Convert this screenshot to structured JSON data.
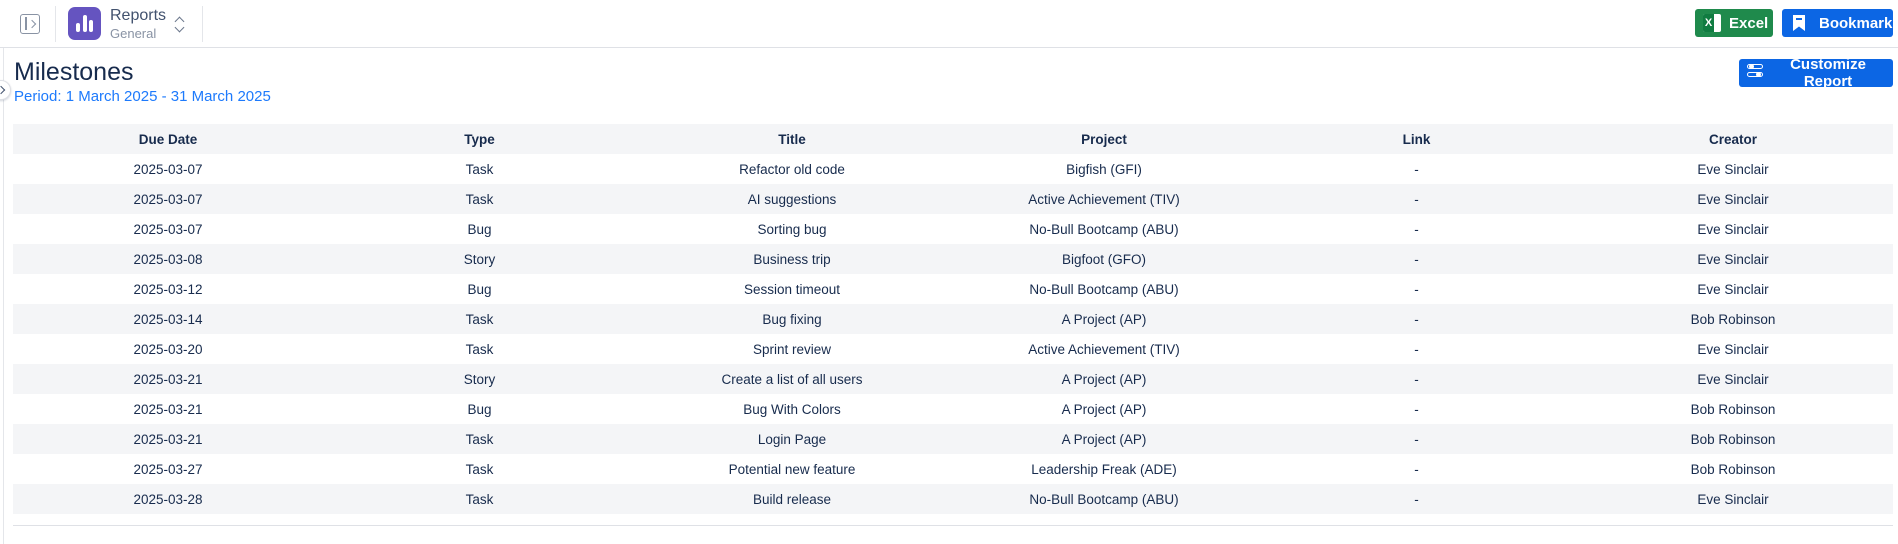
{
  "header": {
    "app_name": "Reports",
    "app_subtitle": "General",
    "excel_label": "Excel",
    "bookmark_label": "Bookmark",
    "icons": [
      "sidebar-toggle-icon",
      "bar-chart-icon",
      "chevron-updown-icon",
      "excel-icon",
      "bookmark-icon"
    ]
  },
  "report": {
    "title": "Milestones",
    "period": "Period: 1 March 2025 - 31 March 2025",
    "customize_label": "Customize Report",
    "customize_icon": "sliders-icon"
  },
  "table": {
    "columns": [
      "Due Date",
      "Type",
      "Title",
      "Project",
      "Link",
      "Creator"
    ],
    "rows": [
      [
        "2025-03-07",
        "Task",
        "Refactor old code",
        "Bigfish (GFI)",
        "-",
        "Eve Sinclair"
      ],
      [
        "2025-03-07",
        "Task",
        "AI suggestions",
        "Active Achievement (TIV)",
        "-",
        "Eve Sinclair"
      ],
      [
        "2025-03-07",
        "Bug",
        "Sorting bug",
        "No-Bull Bootcamp (ABU)",
        "-",
        "Eve Sinclair"
      ],
      [
        "2025-03-08",
        "Story",
        "Business trip",
        "Bigfoot (GFO)",
        "-",
        "Eve Sinclair"
      ],
      [
        "2025-03-12",
        "Bug",
        "Session timeout",
        "No-Bull Bootcamp (ABU)",
        "-",
        "Eve Sinclair"
      ],
      [
        "2025-03-14",
        "Task",
        "Bug fixing",
        "A Project (AP)",
        "-",
        "Bob Robinson"
      ],
      [
        "2025-03-20",
        "Task",
        "Sprint review",
        "Active Achievement (TIV)",
        "-",
        "Eve Sinclair"
      ],
      [
        "2025-03-21",
        "Story",
        "Create a list of all users",
        "A Project (AP)",
        "-",
        "Eve Sinclair"
      ],
      [
        "2025-03-21",
        "Bug",
        "Bug With Colors",
        "A Project (AP)",
        "-",
        "Bob Robinson"
      ],
      [
        "2025-03-21",
        "Task",
        "Login Page",
        "A Project (AP)",
        "-",
        "Bob Robinson"
      ],
      [
        "2025-03-27",
        "Task",
        "Potential new feature",
        "Leadership Freak (ADE)",
        "-",
        "Bob Robinson"
      ],
      [
        "2025-03-28",
        "Task",
        "Build release",
        "No-Bull Bootcamp (ABU)",
        "-",
        "Eve Sinclair"
      ]
    ]
  },
  "colors": {
    "app_logo": "#6554c0",
    "excel_button": "#1f8a4c",
    "primary_button": "#0c66e4",
    "period_text": "#1d7afc",
    "row_stripe": "#f4f5f7"
  }
}
